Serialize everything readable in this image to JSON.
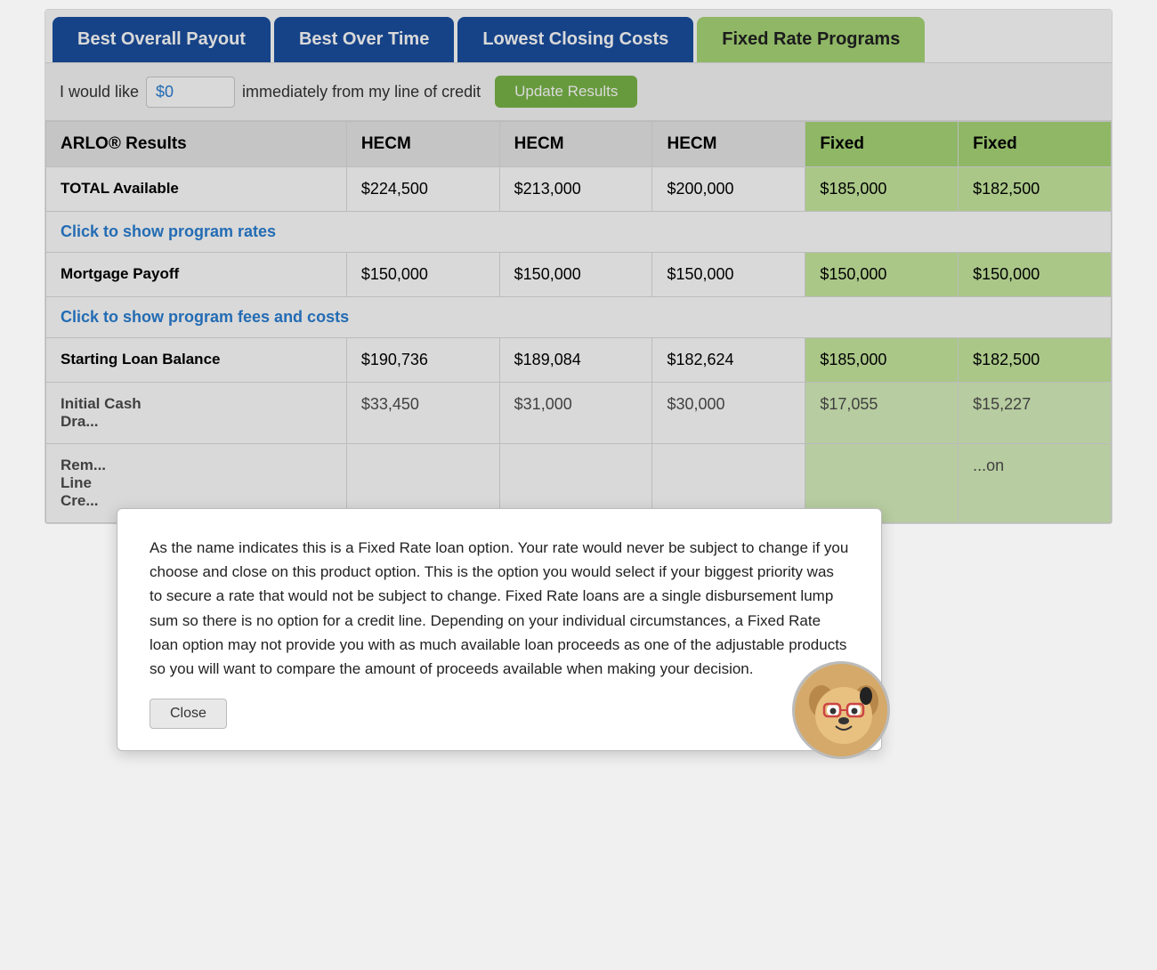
{
  "tabs": [
    {
      "id": "best-overall",
      "label": "Best Overall Payout",
      "style": "blue",
      "active": true
    },
    {
      "id": "best-over-time",
      "label": "Best Over Time",
      "style": "blue",
      "active": false
    },
    {
      "id": "lowest-closing",
      "label": "Lowest Closing Costs",
      "style": "blue",
      "active": false
    },
    {
      "id": "fixed-rate",
      "label": "Fixed Rate Programs",
      "style": "green-light",
      "active": false
    }
  ],
  "input_row": {
    "prefix": "I would like",
    "value": "$0",
    "suffix": "immediately from my line of credit",
    "button_label": "Update Results"
  },
  "table": {
    "headers": [
      {
        "label": "ARLO® Results",
        "col_class": ""
      },
      {
        "label": "HECM",
        "col_class": ""
      },
      {
        "label": "HECM",
        "col_class": ""
      },
      {
        "label": "HECM",
        "col_class": ""
      },
      {
        "label": "Fixed",
        "col_class": "green-col"
      },
      {
        "label": "Fixed",
        "col_class": "green-col"
      }
    ],
    "rows": [
      {
        "type": "data",
        "cells": [
          {
            "label": "TOTAL Available",
            "col_class": ""
          },
          {
            "value": "$224,500",
            "col_class": ""
          },
          {
            "value": "$213,000",
            "col_class": ""
          },
          {
            "value": "$200,000",
            "col_class": ""
          },
          {
            "value": "$185,000",
            "col_class": "green-col"
          },
          {
            "value": "$182,500",
            "col_class": "green-col"
          }
        ]
      },
      {
        "type": "link",
        "link_text": "Click to show program rates",
        "colspan": 6
      },
      {
        "type": "data",
        "cells": [
          {
            "label": "Mortgage Payoff",
            "col_class": ""
          },
          {
            "value": "$150,000",
            "col_class": ""
          },
          {
            "value": "$150,000",
            "col_class": ""
          },
          {
            "value": "$150,000",
            "col_class": ""
          },
          {
            "value": "$150,000",
            "col_class": "green-col"
          },
          {
            "value": "$150,000",
            "col_class": "green-col"
          }
        ]
      },
      {
        "type": "link",
        "link_text": "Click to show program fees and costs",
        "colspan": 6
      },
      {
        "type": "data",
        "cells": [
          {
            "label": "Starting Loan Balance",
            "col_class": ""
          },
          {
            "value": "$190,736",
            "col_class": ""
          },
          {
            "value": "$189,084",
            "col_class": ""
          },
          {
            "value": "$182,624",
            "col_class": ""
          },
          {
            "value": "$185,000",
            "col_class": "green-col"
          },
          {
            "value": "$182,500",
            "col_class": "green-col"
          }
        ]
      },
      {
        "type": "partial",
        "cells": [
          {
            "label": "Initial Cash Dra...",
            "col_class": ""
          },
          {
            "value": "$33,450",
            "col_class": ""
          },
          {
            "value": "$31,000",
            "col_class": ""
          },
          {
            "value": "$30,000",
            "col_class": ""
          },
          {
            "value": "$17,055",
            "col_class": "green-col"
          },
          {
            "value": "$15,227",
            "col_class": "green-col"
          }
        ]
      },
      {
        "type": "partial",
        "cells": [
          {
            "label": "Remaining Line of Cre...",
            "col_class": ""
          },
          {
            "value": "",
            "col_class": ""
          },
          {
            "value": "",
            "col_class": ""
          },
          {
            "value": "",
            "col_class": ""
          },
          {
            "value": "",
            "col_class": "green-col"
          },
          {
            "value": "...on",
            "col_class": "green-col"
          }
        ]
      }
    ]
  },
  "modal": {
    "visible": true,
    "text": "As the name indicates this is a Fixed Rate loan option. Your rate would never be subject to change if you choose and close on this product option. This is the option you would select if your biggest priority was to secure a rate that would not be subject to change. Fixed Rate loans are a single disbursement lump sum so there is no option for a credit line. Depending on your individual circumstances, a Fixed Rate loan option may not provide you with as much available loan proceeds as one of the adjustable products so you will want to compare the amount of proceeds available when making your decision.",
    "close_label": "Close"
  }
}
